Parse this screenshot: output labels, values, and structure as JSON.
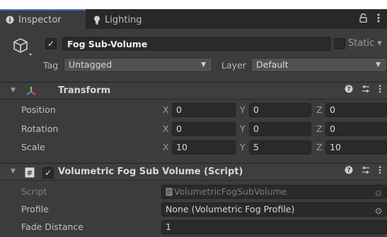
{
  "tabs": {
    "inspector_label": "Inspector",
    "lighting_label": "Lighting"
  },
  "gameobject": {
    "name": "Fog Sub-Volume",
    "active": true,
    "static_label": "Static",
    "tag_label": "Tag",
    "tag_value": "Untagged",
    "layer_label": "Layer",
    "layer_value": "Default"
  },
  "transform": {
    "title": "Transform",
    "position_label": "Position",
    "rotation_label": "Rotation",
    "scale_label": "Scale",
    "axis_x": "X",
    "axis_y": "Y",
    "axis_z": "Z",
    "position": {
      "x": "0",
      "y": "0",
      "z": "0"
    },
    "rotation": {
      "x": "0",
      "y": "0",
      "z": "0"
    },
    "scale": {
      "x": "10",
      "y": "5",
      "z": "10"
    }
  },
  "script_component": {
    "title": "Volumetric Fog Sub Volume (Script)",
    "enabled": true,
    "script_label": "Script",
    "script_value": "VolumetricFogSubVolume",
    "profile_label": "Profile",
    "profile_value": "None (Volumetric Fog Profile)",
    "fade_label": "Fade Distance",
    "fade_value": "1"
  },
  "colors": {
    "accent": "#3a79bb",
    "panel": "#3c3c3c",
    "field": "#2a2a2a"
  }
}
